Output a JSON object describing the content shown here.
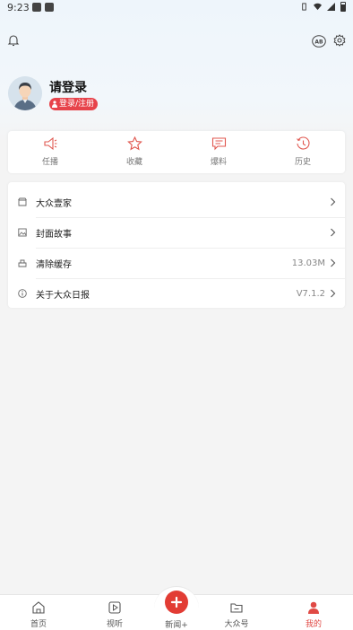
{
  "status_bar": {
    "time": "9:23"
  },
  "header": {
    "ab_label": "AB"
  },
  "profile": {
    "title": "请登录",
    "badge": "登录/注册"
  },
  "quick_actions": [
    {
      "label": "任播",
      "icon": "megaphone-icon"
    },
    {
      "label": "收藏",
      "icon": "star-icon"
    },
    {
      "label": "爆料",
      "icon": "message-icon"
    },
    {
      "label": "历史",
      "icon": "history-icon"
    }
  ],
  "menu": [
    {
      "label": "大众壹家",
      "value": "",
      "icon": "store-icon"
    },
    {
      "label": "封面故事",
      "value": "",
      "icon": "image-icon"
    },
    {
      "label": "清除缓存",
      "value": "13.03M",
      "icon": "broom-icon"
    },
    {
      "label": "关于大众日报",
      "value": "V7.1.2",
      "icon": "info-icon"
    }
  ],
  "tabbar": [
    {
      "label": "首页",
      "icon": "home-icon"
    },
    {
      "label": "视听",
      "icon": "play-icon"
    },
    {
      "label": "新闻+",
      "icon": "plus-icon"
    },
    {
      "label": "大众号",
      "icon": "folder-icon"
    },
    {
      "label": "我的",
      "icon": "user-icon"
    }
  ],
  "colors": {
    "accent": "#e23c34",
    "badge": "#e7434b"
  }
}
